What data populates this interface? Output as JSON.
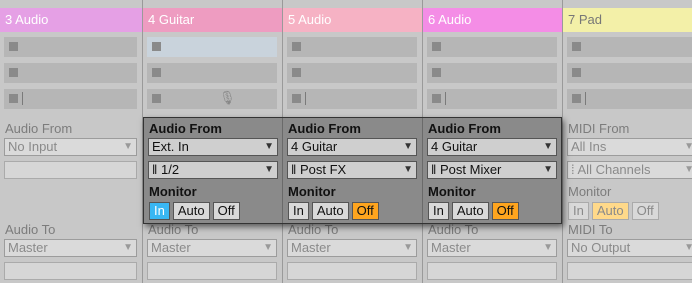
{
  "tracks": [
    {
      "name": "3 Audio",
      "header_color": "#e5a0e5",
      "from_label": "Audio From",
      "from_value": "No Input",
      "to_label": "Audio To",
      "to_value": "Master"
    },
    {
      "name": "4 Guitar",
      "header_color": "#ee9cc1",
      "from_label": "Audio From",
      "from_value": "Ext. In",
      "channel_value": "1/2",
      "monitor_label": "Monitor",
      "to_label": "Audio To",
      "to_value": "Master"
    },
    {
      "name": "5 Audio",
      "header_color": "#f6b2c4",
      "from_label": "Audio From",
      "from_value": "4 Guitar",
      "channel_value": "Post FX",
      "monitor_label": "Monitor",
      "to_label": "Audio To",
      "to_value": "Master"
    },
    {
      "name": "6 Audio",
      "header_color": "#f48de6",
      "from_label": "Audio From",
      "from_value": "4 Guitar",
      "channel_value": "Post Mixer",
      "monitor_label": "Monitor",
      "to_label": "Audio To",
      "to_value": "Master"
    },
    {
      "name": "7 Pad",
      "header_color": "#f3f0a8",
      "from_label": "MIDI From",
      "from_value": "All Ins",
      "channel_value": "All Channels",
      "monitor_label": "Monitor",
      "to_label": "MIDI To",
      "to_value": "No Output"
    }
  ],
  "monitor": {
    "in": "In",
    "auto": "Auto",
    "off": "Off"
  },
  "monitor_states": [
    "",
    "in",
    "off",
    "off",
    "auto"
  ],
  "colors": {
    "monitor_in_active": "#39b7f3",
    "monitor_off_active": "#ffa51e",
    "monitor_auto_active": "#ffd98a",
    "panel": "#8a8a8a",
    "background": "#c8c8c8"
  },
  "icons": {
    "stop": "clip-stop-icon",
    "mic": "microphone-icon",
    "dropdown": "chevron-down-icon",
    "input_channel": "input-channel-icon"
  }
}
